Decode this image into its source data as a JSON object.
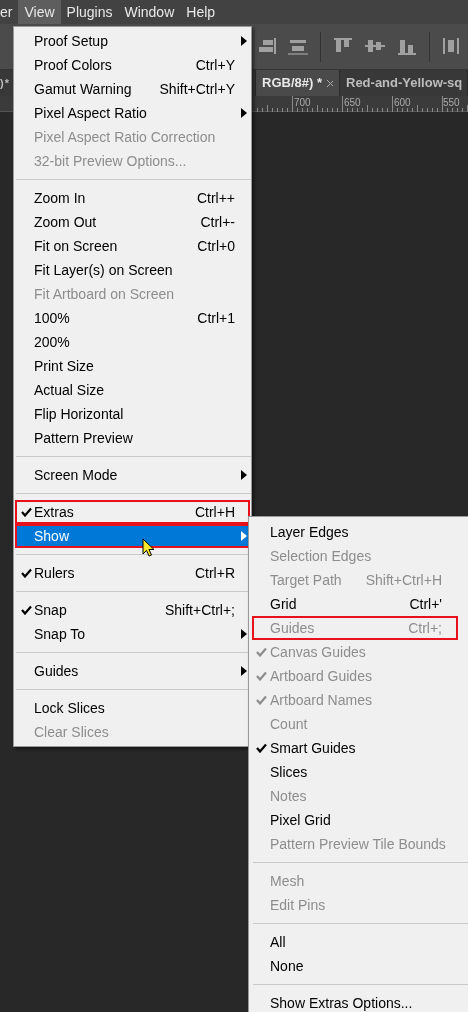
{
  "menu_bar": [
    {
      "label": "er",
      "selected": false
    },
    {
      "label": "View",
      "selected": true
    },
    {
      "label": "Plugins",
      "selected": false
    },
    {
      "label": "Window",
      "selected": false
    },
    {
      "label": "Help",
      "selected": false
    }
  ],
  "document_tabs": [
    {
      "label": ") *",
      "selected": false,
      "closable": false
    },
    {
      "label": "RGB/8#) *",
      "selected": true,
      "closable": true
    },
    {
      "label": "Red-and-Yellow-sq",
      "selected": false,
      "closable": false
    }
  ],
  "ruler": [
    "700",
    "650",
    "600",
    "550"
  ],
  "view_menu": [
    {
      "kind": "submenu",
      "label": "Proof Setup",
      "disabled": false,
      "checked": false,
      "selected": false,
      "outlined": false
    },
    {
      "kind": "item",
      "label": "Proof Colors",
      "shortcut": "Ctrl+Y",
      "disabled": false,
      "checked": false,
      "selected": false,
      "outlined": false
    },
    {
      "kind": "item",
      "label": "Gamut Warning",
      "shortcut": "Shift+Ctrl+Y",
      "disabled": false,
      "checked": false,
      "selected": false,
      "outlined": false
    },
    {
      "kind": "submenu",
      "label": "Pixel Aspect Ratio",
      "disabled": false,
      "checked": false,
      "selected": false,
      "outlined": false
    },
    {
      "kind": "item",
      "label": "Pixel Aspect Ratio Correction",
      "disabled": true,
      "checked": false,
      "selected": false,
      "outlined": false
    },
    {
      "kind": "item",
      "label": "32-bit Preview Options...",
      "disabled": true,
      "checked": false,
      "selected": false,
      "outlined": false
    },
    {
      "kind": "separator"
    },
    {
      "kind": "item",
      "label": "Zoom In",
      "shortcut": "Ctrl++",
      "disabled": false,
      "checked": false,
      "selected": false,
      "outlined": false
    },
    {
      "kind": "item",
      "label": "Zoom Out",
      "shortcut": "Ctrl+-",
      "disabled": false,
      "checked": false,
      "selected": false,
      "outlined": false
    },
    {
      "kind": "item",
      "label": "Fit on Screen",
      "shortcut": "Ctrl+0",
      "disabled": false,
      "checked": false,
      "selected": false,
      "outlined": false
    },
    {
      "kind": "item",
      "label": "Fit Layer(s) on Screen",
      "disabled": false,
      "checked": false,
      "selected": false,
      "outlined": false
    },
    {
      "kind": "item",
      "label": "Fit Artboard on Screen",
      "disabled": true,
      "checked": false,
      "selected": false,
      "outlined": false
    },
    {
      "kind": "item",
      "label": "100%",
      "shortcut": "Ctrl+1",
      "disabled": false,
      "checked": false,
      "selected": false,
      "outlined": false
    },
    {
      "kind": "item",
      "label": "200%",
      "disabled": false,
      "checked": false,
      "selected": false,
      "outlined": false
    },
    {
      "kind": "item",
      "label": "Print Size",
      "disabled": false,
      "checked": false,
      "selected": false,
      "outlined": false
    },
    {
      "kind": "item",
      "label": "Actual Size",
      "disabled": false,
      "checked": false,
      "selected": false,
      "outlined": false
    },
    {
      "kind": "item",
      "label": "Flip Horizontal",
      "disabled": false,
      "checked": false,
      "selected": false,
      "outlined": false
    },
    {
      "kind": "item",
      "label": "Pattern Preview",
      "disabled": false,
      "checked": false,
      "selected": false,
      "outlined": false
    },
    {
      "kind": "separator"
    },
    {
      "kind": "submenu",
      "label": "Screen Mode",
      "disabled": false,
      "checked": false,
      "selected": false,
      "outlined": false
    },
    {
      "kind": "separator"
    },
    {
      "kind": "item",
      "label": "Extras",
      "shortcut": "Ctrl+H",
      "disabled": false,
      "checked": true,
      "selected": false,
      "outlined": true
    },
    {
      "kind": "submenu",
      "label": "Show",
      "disabled": false,
      "checked": false,
      "selected": true,
      "outlined": true
    },
    {
      "kind": "separator"
    },
    {
      "kind": "item",
      "label": "Rulers",
      "shortcut": "Ctrl+R",
      "disabled": false,
      "checked": true,
      "selected": false,
      "outlined": false
    },
    {
      "kind": "separator"
    },
    {
      "kind": "item",
      "label": "Snap",
      "shortcut": "Shift+Ctrl+;",
      "disabled": false,
      "checked": true,
      "selected": false,
      "outlined": false
    },
    {
      "kind": "submenu",
      "label": "Snap To",
      "disabled": false,
      "checked": false,
      "selected": false,
      "outlined": false
    },
    {
      "kind": "separator"
    },
    {
      "kind": "submenu",
      "label": "Guides",
      "disabled": false,
      "checked": false,
      "selected": false,
      "outlined": false
    },
    {
      "kind": "separator"
    },
    {
      "kind": "item",
      "label": "Lock Slices",
      "disabled": false,
      "checked": false,
      "selected": false,
      "outlined": false
    },
    {
      "kind": "item",
      "label": "Clear Slices",
      "disabled": true,
      "checked": false,
      "selected": false,
      "outlined": false
    }
  ],
  "show_submenu": [
    {
      "kind": "item",
      "label": "Layer Edges",
      "disabled": false,
      "checked": false,
      "outlined": false
    },
    {
      "kind": "item",
      "label": "Selection Edges",
      "disabled": true,
      "checked": false,
      "outlined": false
    },
    {
      "kind": "item",
      "label": "Target Path",
      "shortcut": "Shift+Ctrl+H",
      "disabled": true,
      "checked": false,
      "outlined": false
    },
    {
      "kind": "item",
      "label": "Grid",
      "shortcut": "Ctrl+'",
      "disabled": false,
      "checked": false,
      "outlined": false
    },
    {
      "kind": "item",
      "label": "Guides",
      "shortcut": "Ctrl+;",
      "disabled": true,
      "checked": false,
      "outlined": true
    },
    {
      "kind": "item",
      "label": "Canvas Guides",
      "disabled": true,
      "checked": true,
      "outlined": false
    },
    {
      "kind": "item",
      "label": "Artboard Guides",
      "disabled": true,
      "checked": true,
      "outlined": false
    },
    {
      "kind": "item",
      "label": "Artboard Names",
      "disabled": true,
      "checked": true,
      "outlined": false
    },
    {
      "kind": "item",
      "label": "Count",
      "disabled": true,
      "checked": false,
      "outlined": false
    },
    {
      "kind": "item",
      "label": "Smart Guides",
      "disabled": false,
      "checked": true,
      "outlined": false
    },
    {
      "kind": "item",
      "label": "Slices",
      "disabled": false,
      "checked": false,
      "outlined": false
    },
    {
      "kind": "item",
      "label": "Notes",
      "disabled": true,
      "checked": false,
      "outlined": false
    },
    {
      "kind": "item",
      "label": "Pixel Grid",
      "disabled": false,
      "checked": false,
      "outlined": false
    },
    {
      "kind": "item",
      "label": "Pattern Preview Tile Bounds",
      "disabled": true,
      "checked": false,
      "outlined": false
    },
    {
      "kind": "separator"
    },
    {
      "kind": "item",
      "label": "Mesh",
      "disabled": true,
      "checked": false,
      "outlined": false
    },
    {
      "kind": "item",
      "label": "Edit Pins",
      "disabled": true,
      "checked": false,
      "outlined": false
    },
    {
      "kind": "separator"
    },
    {
      "kind": "item",
      "label": "All",
      "disabled": false,
      "checked": false,
      "outlined": false
    },
    {
      "kind": "item",
      "label": "None",
      "disabled": false,
      "checked": false,
      "outlined": false
    },
    {
      "kind": "separator"
    },
    {
      "kind": "item",
      "label": "Show Extras Options...",
      "disabled": false,
      "checked": false,
      "outlined": false
    }
  ]
}
